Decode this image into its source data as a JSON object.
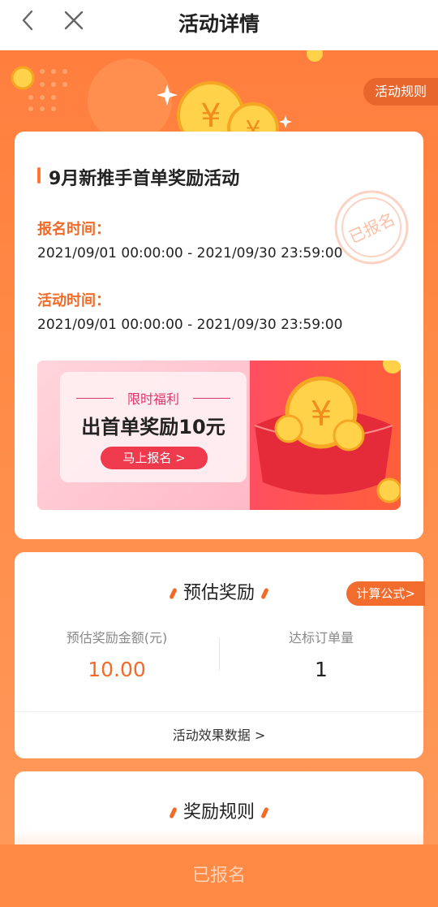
{
  "nav": {
    "title": "活动详情",
    "back_icon": "chevron-left-icon",
    "close_icon": "close-icon"
  },
  "header": {
    "rules_tag": "活动规则"
  },
  "activity": {
    "title": "9月新推手首单奖励活动",
    "stamp_text": "已报名",
    "signup_time_label": "报名时间：",
    "signup_time": "2021/09/01 00:00:00 - 2021/09/30 23:59:00",
    "activity_time_label": "活动时间：",
    "activity_time": "2021/09/01 00:00:00 - 2021/09/30 23:59:00"
  },
  "banner": {
    "limited_label": "限时福利",
    "headline": "出首单奖励10元",
    "signup_button": "马上报名 >"
  },
  "estimate": {
    "title": "预估奖励",
    "formula_button": "计算公式>",
    "amount_label": "预估奖励金额(元)",
    "amount_value": "10.00",
    "orders_label": "达标订单量",
    "orders_value": "1",
    "effect_link": "活动效果数据 >"
  },
  "rules_section": {
    "title": "奖励规则"
  },
  "bottom": {
    "button_label": "已报名"
  },
  "colors": {
    "brand_orange": "#ff8a45",
    "accent": "#f36a27",
    "banner_red": "#ef3a4e"
  }
}
